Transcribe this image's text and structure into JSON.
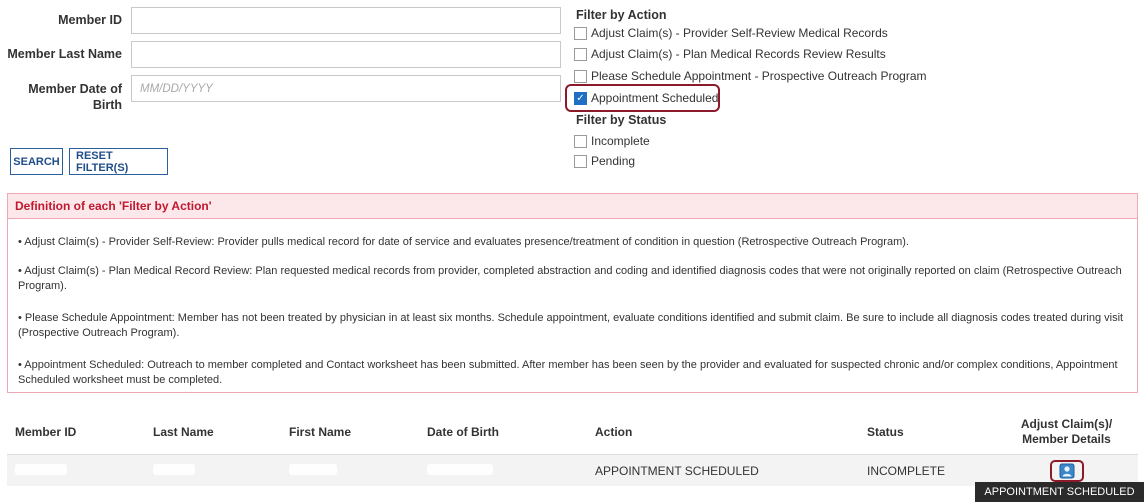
{
  "form": {
    "member_id_label": "Member ID",
    "member_id_value": "",
    "last_name_label": "Member Last Name",
    "last_name_value": "",
    "dob_label_line1": "Member Date of",
    "dob_label_line2": "Birth",
    "dob_placeholder": "MM/DD/YYYY",
    "search_label": "SEARCH",
    "reset_label": "RESET FILTER(S)"
  },
  "filters": {
    "action_heading": "Filter by Action",
    "actions": [
      {
        "label": "Adjust Claim(s) - Provider Self-Review Medical Records",
        "checked": false
      },
      {
        "label": "Adjust Claim(s) - Plan Medical Records Review Results",
        "checked": false
      },
      {
        "label": "Please Schedule Appointment - Prospective Outreach Program",
        "checked": false
      },
      {
        "label": "Appointment Scheduled",
        "checked": true
      }
    ],
    "status_heading": "Filter by Status",
    "statuses": [
      {
        "label": "Incomplete",
        "checked": false
      },
      {
        "label": "Pending",
        "checked": false
      }
    ]
  },
  "definitions": {
    "heading": "Definition of each 'Filter by Action'",
    "items": [
      "•     Adjust Claim(s) - Provider Self-Review:  Provider pulls medical record for date of service and evaluates presence/treatment of condition in question (Retrospective Outreach Program).",
      "•     Adjust Claim(s) - Plan Medical Record Review: Plan requested medical records from provider, completed abstraction and coding and identified diagnosis codes that were not originally reported on claim (Retrospective Outreach Program).",
      "•     Please Schedule Appointment: Member has not been treated by physician in at least six months.  Schedule appointment, evaluate conditions identified and submit claim. Be sure to include all diagnosis codes treated during visit (Prospective Outreach Program).",
      "•     Appointment Scheduled: Outreach to member completed and Contact worksheet has been submitted. After member has been seen by the provider and evaluated for suspected chronic and/or complex conditions, Appointment Scheduled worksheet must be completed."
    ]
  },
  "table": {
    "headers": [
      "Member ID",
      "Last Name",
      "First Name",
      "Date of Birth",
      "Action",
      "Status"
    ],
    "last_header_line1": "Adjust Claim(s)/",
    "last_header_line2": "Member Details",
    "row": {
      "action": "APPOINTMENT SCHEDULED",
      "status": "INCOMPLETE",
      "details_icon": "member-details-icon"
    }
  },
  "tooltip": "APPOINTMENT SCHEDULED",
  "colors": {
    "accent": "#1f4e89",
    "highlight": "#8b1a2b",
    "def_header_bg": "#fce8ea",
    "def_header_text": "#c0182f",
    "checkbox_checked": "#1f6fc5"
  }
}
